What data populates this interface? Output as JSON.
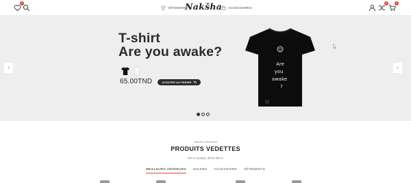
{
  "header": {
    "brand": "Nakšha",
    "nav": [
      {
        "label": "VÊTEMENTS",
        "icon": "shirt-icon"
      },
      {
        "label": "ACCESSOIRES",
        "icon": "bag-icon"
      }
    ],
    "wishlist_count": "0",
    "compare_count": "0",
    "cart_count": "0"
  },
  "hero": {
    "title_line1": "T-shirt",
    "title_line2": "Are you awake?",
    "price": "65.00TND",
    "cart_button": "AJOUTER AU PANIER",
    "tee_text": [
      "Are",
      "you",
      "awake",
      "?"
    ],
    "slides_total": 3,
    "slide_active": 1
  },
  "featured": {
    "kicker": "Naksha Collections",
    "title": "PRODUITS VEDETTES",
    "subtitle": "Life is a party, dress like it.",
    "tabs": [
      "MEILLEURS VENDEURS",
      "SOLDES",
      "ACCESSOIRE",
      "VÊTEMENTS"
    ],
    "active_tab": 0
  },
  "colors": {
    "accent": "#e2403a",
    "dark": "#2b2b2b",
    "hero_bg": "#eeeeee"
  }
}
